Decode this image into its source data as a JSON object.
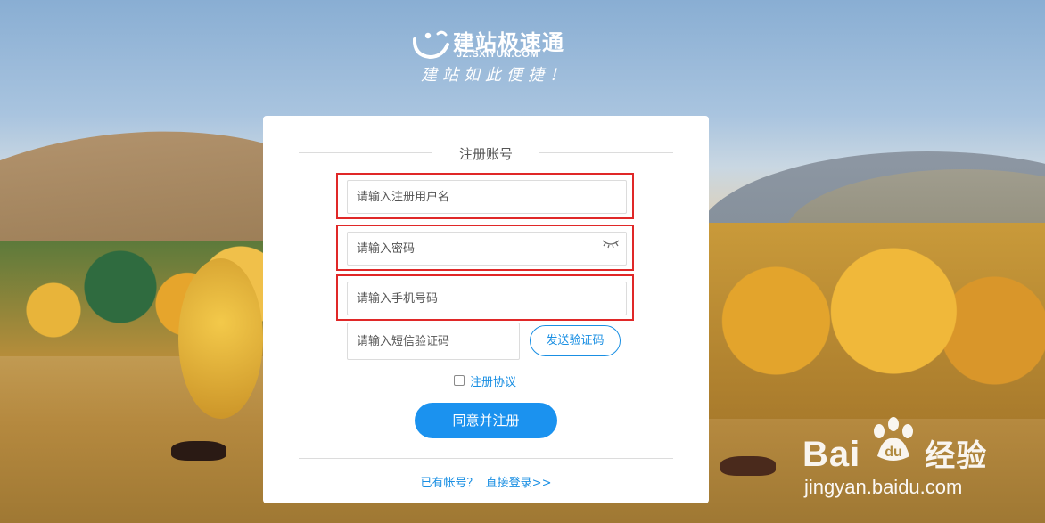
{
  "logo": {
    "name": "建站极速通",
    "domain": "JZ.SXIYUN.COM",
    "slogan": "建站如此便捷！"
  },
  "register": {
    "title": "注册账号",
    "username_placeholder": "请输入注册用户名",
    "password_placeholder": "请输入密码",
    "phone_placeholder": "请输入手机号码",
    "sms_placeholder": "请输入短信验证码",
    "send_code_label": "发送验证码",
    "agreement_label": "注册协议",
    "agreement_checked": false,
    "submit_label": "同意并注册",
    "have_account_text": "已有帐号？",
    "login_link_label": "直接登录>>"
  },
  "watermark": {
    "brand_prefix": "Bai",
    "brand_suffix": "经验",
    "url": "jingyan.baidu.com"
  },
  "colors": {
    "accent": "#1b92ef",
    "highlight_border": "#e02828"
  }
}
